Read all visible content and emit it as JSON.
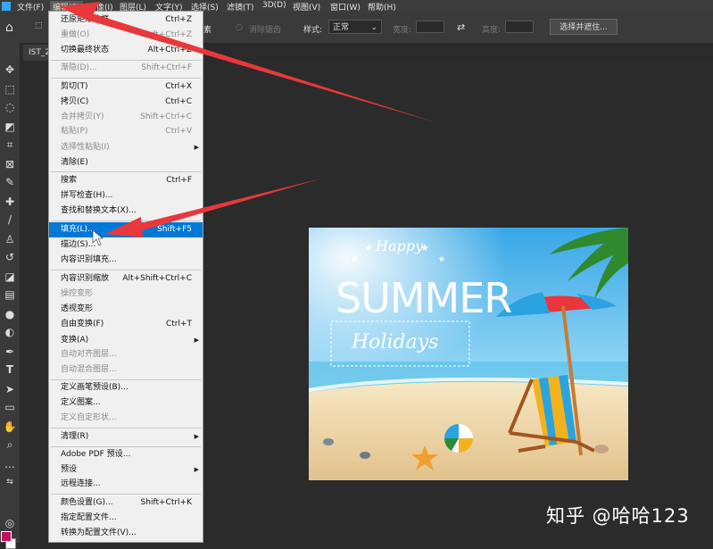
{
  "menubar": {
    "file": "文件(F)",
    "edit": "编辑(E)",
    "image": "像(I)",
    "layer": "图层(L)",
    "type": "文字(Y)",
    "select": "选择(S)",
    "filter": "滤镜(T)",
    "three_d": "3D(D)",
    "view": "视图(V)",
    "window": "窗口(W)",
    "help": "帮助(H)"
  },
  "options": {
    "clear_checkbox_label": "消除锯齿",
    "style_label": "样式:",
    "style_value": "正常",
    "width_label": "宽度:",
    "height_label": "高度:",
    "select_mask_button": "选择并遮住...",
    "partial_label": "素"
  },
  "document": {
    "tab_label": "IST_2"
  },
  "edit_menu": {
    "items": [
      {
        "label": "还原矩形选框",
        "shortcut": "Ctrl+Z",
        "enabled": true
      },
      {
        "label": "重做(O)",
        "shortcut": "Shift+Ctrl+Z",
        "enabled": false
      },
      {
        "label": "切换最终状态",
        "shortcut": "Alt+Ctrl+Z",
        "enabled": true
      },
      {
        "label": "渐隐(D)...",
        "shortcut": "Shift+Ctrl+F",
        "enabled": false
      },
      {
        "label": "剪切(T)",
        "shortcut": "Ctrl+X",
        "enabled": true
      },
      {
        "label": "拷贝(C)",
        "shortcut": "Ctrl+C",
        "enabled": true
      },
      {
        "label": "合并拷贝(Y)",
        "shortcut": "Shift+Ctrl+C",
        "enabled": false
      },
      {
        "label": "粘贴(P)",
        "shortcut": "Ctrl+V",
        "enabled": false
      },
      {
        "label": "选择性粘贴(I)",
        "shortcut": "",
        "enabled": false
      },
      {
        "label": "清除(E)",
        "shortcut": "",
        "enabled": true
      },
      {
        "label": "搜索",
        "shortcut": "Ctrl+F",
        "enabled": true
      },
      {
        "label": "拼写检查(H)...",
        "shortcut": "",
        "enabled": true
      },
      {
        "label": "查找和替换文本(X)...",
        "shortcut": "",
        "enabled": true
      },
      {
        "label": "填充(L)...",
        "shortcut": "Shift+F5",
        "enabled": true
      },
      {
        "label": "描边(S)...",
        "shortcut": "",
        "enabled": true
      },
      {
        "label": "内容识别填充...",
        "shortcut": "",
        "enabled": true
      },
      {
        "label": "内容识别缩放",
        "shortcut": "Alt+Shift+Ctrl+C",
        "enabled": true
      },
      {
        "label": "操控变形",
        "shortcut": "",
        "enabled": false
      },
      {
        "label": "透视变形",
        "shortcut": "",
        "enabled": true
      },
      {
        "label": "自由变换(F)",
        "shortcut": "Ctrl+T",
        "enabled": true
      },
      {
        "label": "变换(A)",
        "shortcut": "",
        "enabled": true
      },
      {
        "label": "自动对齐图层...",
        "shortcut": "",
        "enabled": false
      },
      {
        "label": "自动混合图层...",
        "shortcut": "",
        "enabled": false
      },
      {
        "label": "定义画笔预设(B)...",
        "shortcut": "",
        "enabled": true
      },
      {
        "label": "定义图案...",
        "shortcut": "",
        "enabled": true
      },
      {
        "label": "定义自定形状...",
        "shortcut": "",
        "enabled": false
      },
      {
        "label": "清理(R)",
        "shortcut": "",
        "enabled": true
      },
      {
        "label": "Adobe PDF 预设...",
        "shortcut": "",
        "enabled": true
      },
      {
        "label": "预设",
        "shortcut": "",
        "enabled": true
      },
      {
        "label": "远程连接...",
        "shortcut": "",
        "enabled": true
      },
      {
        "label": "颜色设置(G)...",
        "shortcut": "Shift+Ctrl+K",
        "enabled": true
      },
      {
        "label": "指定配置文件...",
        "shortcut": "",
        "enabled": true
      },
      {
        "label": "转换为配置文件(V)...",
        "shortcut": "",
        "enabled": true
      }
    ]
  },
  "canvas": {
    "happy": "Happy",
    "summer": "SUMMER",
    "holidays": "Holidays"
  },
  "watermark": "知乎 @哈哈123",
  "colors": {
    "menu_highlight": "#0078d7",
    "annotation_arrow": "#e8383b",
    "foreground_swatch": "#c01060",
    "photoshop_blue": "#31a8ff"
  }
}
